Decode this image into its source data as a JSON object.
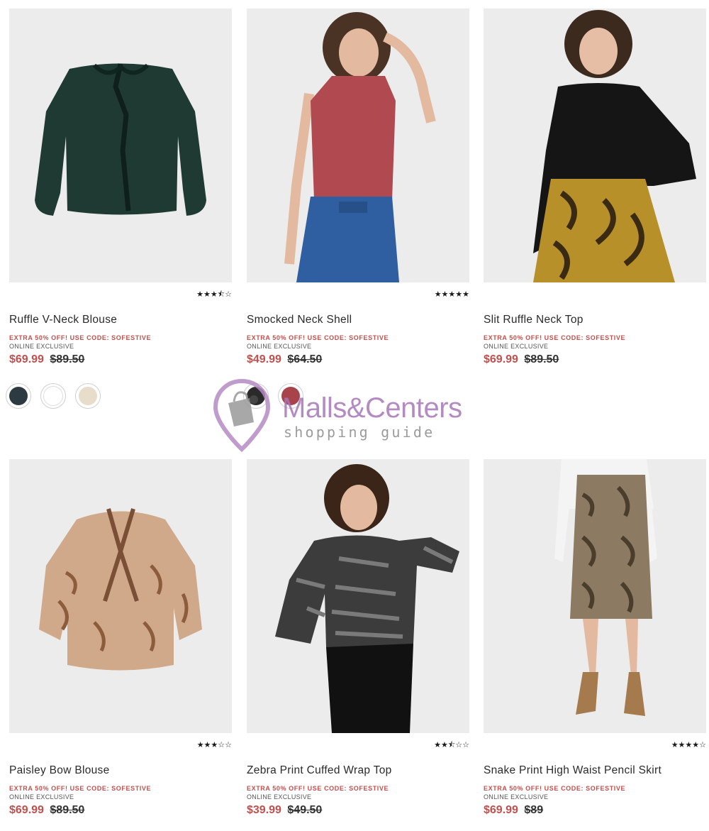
{
  "products": [
    {
      "name": "Ruffle V-Neck Blouse",
      "promo": "EXTRA 50% OFF! USE CODE: SOFESTIVE",
      "exclusive": "ONLINE EXCLUSIVE",
      "sale_price": "$69.99",
      "original_price": "$89.50",
      "rating": 3.5,
      "stars": "★★★⯪☆",
      "swatch_colors": [
        "#2d3a41",
        "#ffffff",
        "#e8dccb"
      ]
    },
    {
      "name": "Smocked Neck Shell",
      "promo": "EXTRA 50% OFF! USE CODE: SOFESTIVE",
      "exclusive": "ONLINE EXCLUSIVE",
      "sale_price": "$49.99",
      "original_price": "$64.50",
      "rating": 5,
      "stars": "★★★★★",
      "swatch_colors": [
        "#2a2a2a",
        "#a8434b"
      ]
    },
    {
      "name": "Slit Ruffle Neck Top",
      "promo": "EXTRA 50% OFF! USE CODE: SOFESTIVE",
      "exclusive": "ONLINE EXCLUSIVE",
      "sale_price": "$69.99",
      "original_price": "$89.50",
      "rating": null,
      "stars": "",
      "swatch_colors": []
    },
    {
      "name": "Paisley Bow Blouse",
      "promo": "EXTRA 50% OFF! USE CODE: SOFESTIVE",
      "exclusive": "ONLINE EXCLUSIVE",
      "sale_price": "$69.99",
      "original_price": "$89.50",
      "rating": 3,
      "stars": "★★★☆☆",
      "swatch_colors": []
    },
    {
      "name": "Zebra Print Cuffed Wrap Top",
      "promo": "EXTRA 50% OFF! USE CODE: SOFESTIVE",
      "exclusive": "ONLINE EXCLUSIVE",
      "sale_price": "$39.99",
      "original_price": "$49.50",
      "rating": 2.5,
      "stars": "★★⯪☆☆",
      "swatch_colors": []
    },
    {
      "name": "Snake Print High Waist Pencil Skirt",
      "promo": "EXTRA 50% OFF! USE CODE: SOFESTIVE",
      "exclusive": "ONLINE EXCLUSIVE",
      "sale_price": "$69.99",
      "original_price": "$89",
      "rating": 4,
      "stars": "★★★★☆",
      "swatch_colors": []
    }
  ],
  "watermark": {
    "title": "Malls&Centers",
    "subtitle": "shopping guide"
  },
  "colors": {
    "sale": "#c0504d",
    "promo": "#c0504d",
    "watermark": "#a677b8"
  }
}
